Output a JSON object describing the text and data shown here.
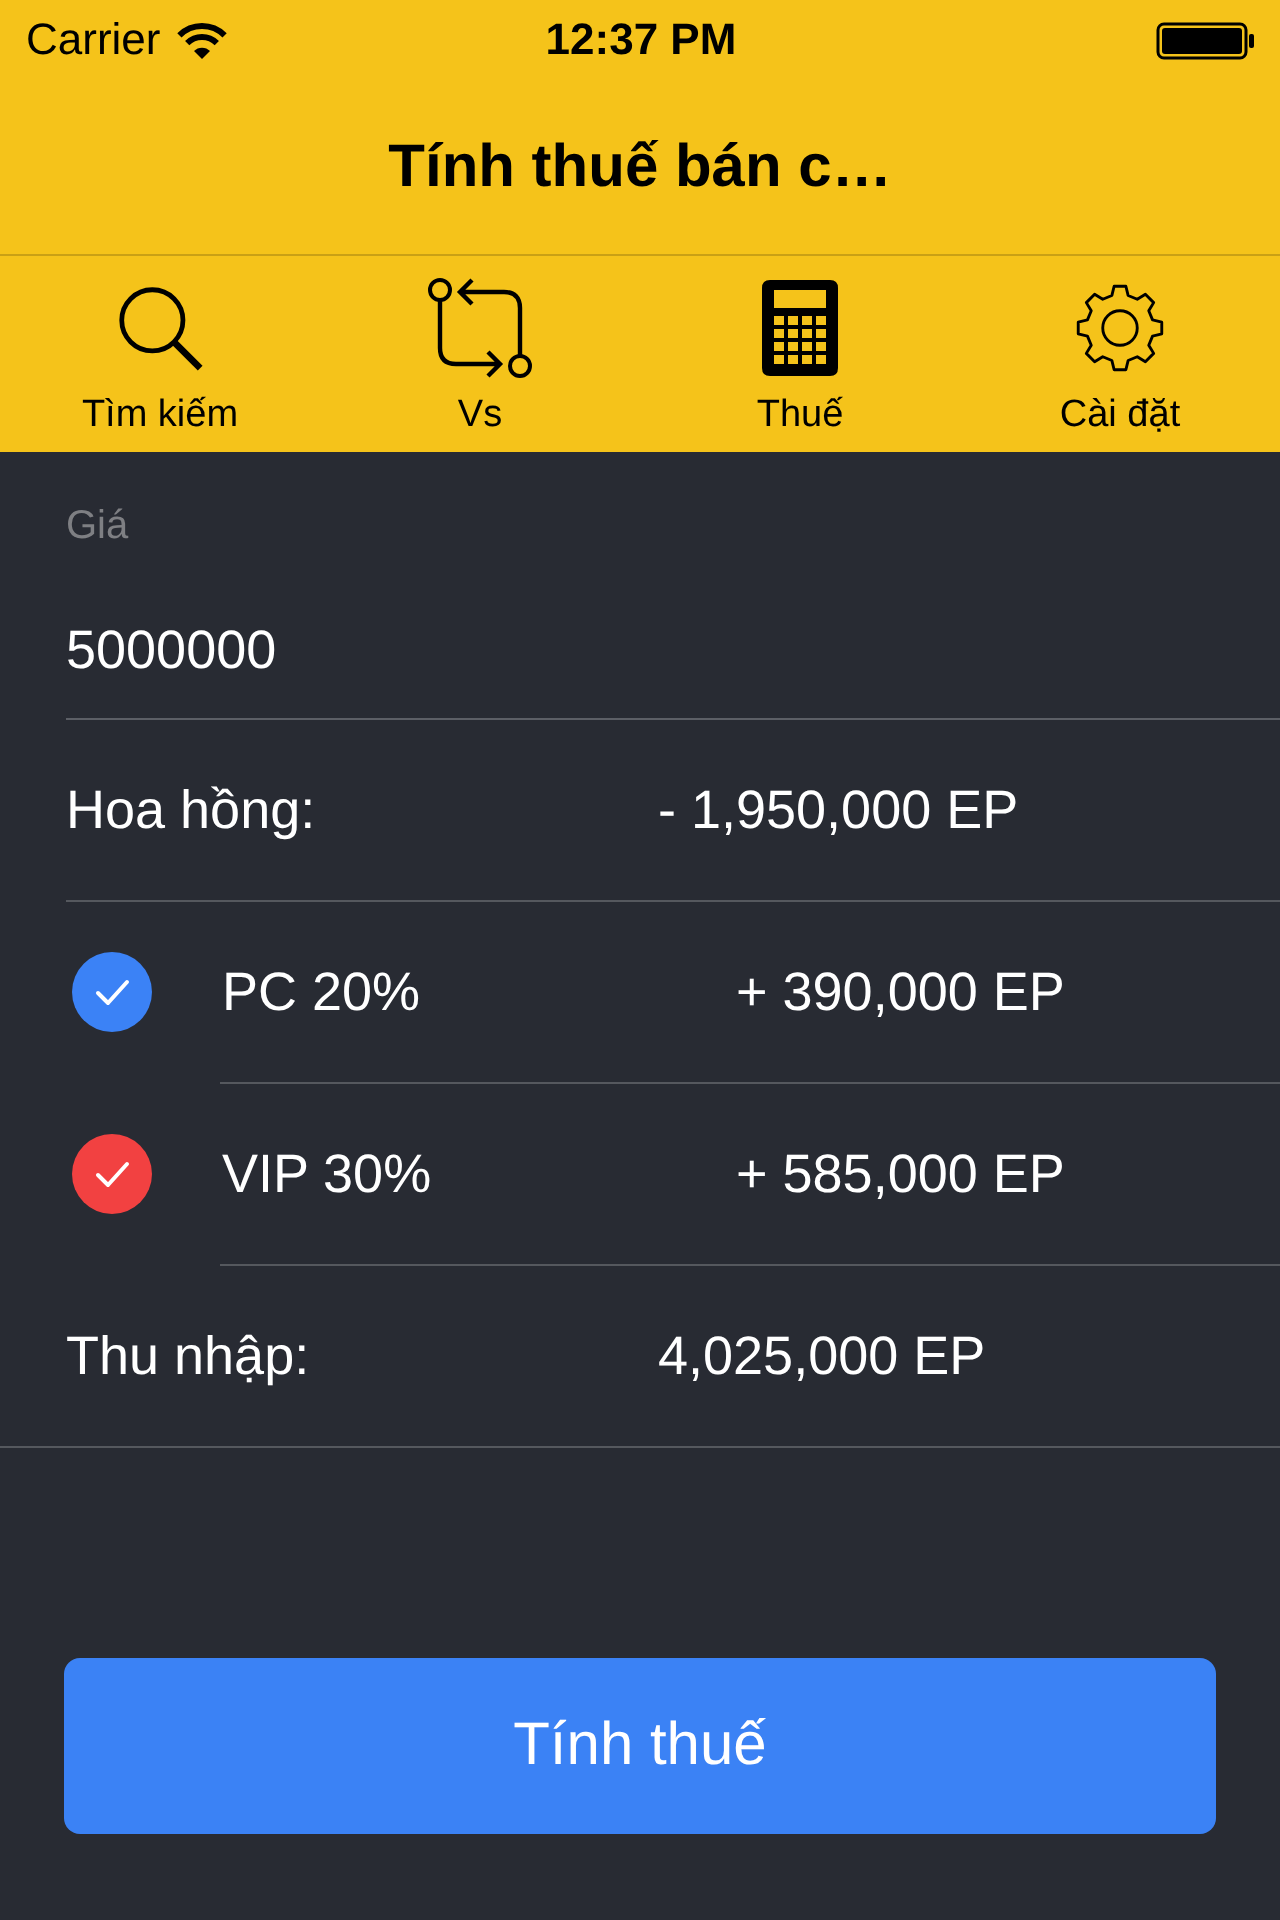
{
  "status_bar": {
    "carrier": "Carrier",
    "time": "12:37 PM"
  },
  "nav_bar": {
    "title": "Tính thuế bán c…"
  },
  "tabs": [
    {
      "label": "Tìm kiếm",
      "selected": false
    },
    {
      "label": "Vs",
      "selected": false
    },
    {
      "label": "Thuế",
      "selected": true
    },
    {
      "label": "Cài đặt",
      "selected": false
    }
  ],
  "price_field": {
    "label": "Giá",
    "value": "5000000"
  },
  "commission": {
    "label": "Hoa hồng:",
    "value": "- 1,950,000 EP"
  },
  "bonuses": [
    {
      "label": "PC 20%",
      "value": "+ 390,000 EP",
      "checked": true,
      "color": "#3b82f6"
    },
    {
      "label": "VIP 30%",
      "value": "+ 585,000 EP",
      "checked": true,
      "color": "#f24141"
    }
  ],
  "income": {
    "label": "Thu nhập:",
    "value": "4,025,000 EP"
  },
  "button": {
    "label": "Tính thuế"
  }
}
